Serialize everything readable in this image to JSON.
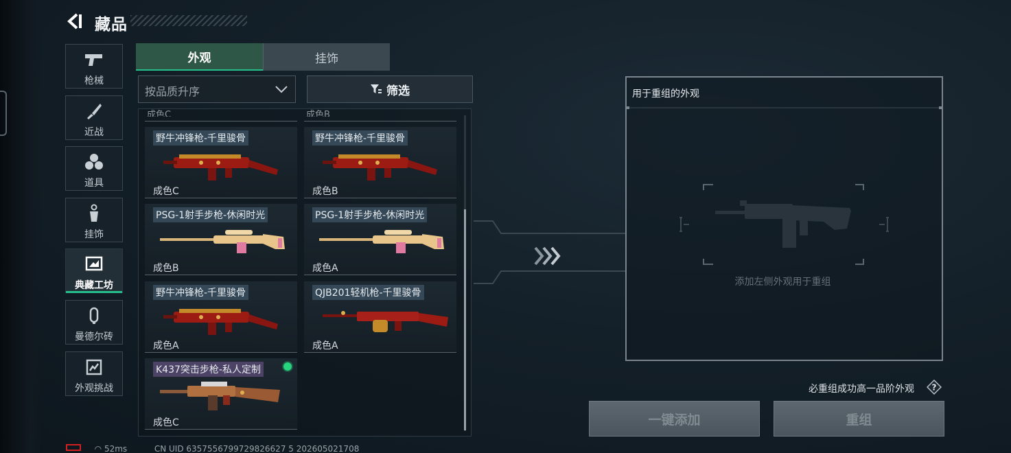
{
  "header": {
    "title": "藏品"
  },
  "categories": [
    {
      "label": "枪械",
      "icon": "pistol-icon"
    },
    {
      "label": "近战",
      "icon": "knife-icon"
    },
    {
      "label": "道具",
      "icon": "grenade-icon"
    },
    {
      "label": "挂饰",
      "icon": "charm-icon"
    },
    {
      "label": "典藏工坊",
      "icon": "workshop-icon",
      "active": true
    },
    {
      "label": "曼德尔砖",
      "icon": "mandel-brick-icon"
    },
    {
      "label": "外观挑战",
      "icon": "challenge-icon"
    }
  ],
  "tabs": {
    "appearance": "外观",
    "pendant": "挂饰",
    "active": "外观"
  },
  "sort": {
    "value": "按品质升序"
  },
  "filter": {
    "label": "筛选"
  },
  "items": [
    {
      "name": "野牛冲锋枪-千里骏骨",
      "wear": "成色C",
      "weapon": "smg",
      "rarity": "blue"
    },
    {
      "name": "野牛冲锋枪-千里骏骨",
      "wear": "成色B",
      "weapon": "smg",
      "rarity": "blue"
    },
    {
      "name": "PSG-1射手步枪-休闲时光",
      "wear": "成色B",
      "weapon": "sniper",
      "rarity": "blue"
    },
    {
      "name": "PSG-1射手步枪-休闲时光",
      "wear": "成色A",
      "weapon": "sniper",
      "rarity": "blue"
    },
    {
      "name": "野牛冲锋枪-千里骏骨",
      "wear": "成色A",
      "weapon": "smg",
      "rarity": "blue"
    },
    {
      "name": "QJB201轻机枪-千里骏骨",
      "wear": "成色A",
      "weapon": "lmg",
      "rarity": "blue"
    },
    {
      "name": "K437突击步枪-私人定制",
      "wear": "成色C",
      "weapon": "rifle",
      "rarity": "purple",
      "new": true
    }
  ],
  "partial_top": [
    "成色C",
    "成色B"
  ],
  "recombine": {
    "title": "用于重组的外观",
    "hint": "添加左侧外观用于重组",
    "note": "必重组成功高一品阶外观",
    "add_all_label": "一键添加",
    "recombine_label": "重组"
  },
  "status": {
    "ping": "52ms",
    "uid": "CN UID 6357556799729826627 5 202605021708"
  },
  "colors": {
    "accent": "#27c08c",
    "new_dot": "#27d47d",
    "rarity_blue": "#4a647a",
    "rarity_purple": "#6e568c"
  }
}
